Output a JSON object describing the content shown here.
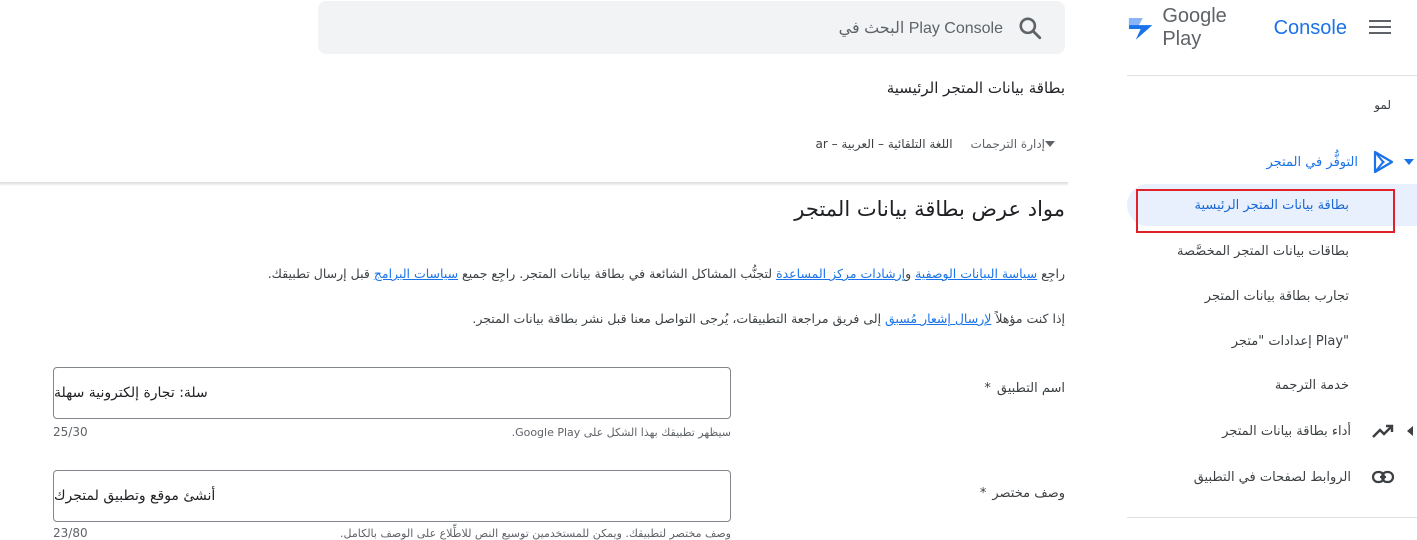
{
  "app": {
    "logo_google_play": "Google Play",
    "logo_console": "Console"
  },
  "search": {
    "placeholder": "البحث في Play Console"
  },
  "sidebar": {
    "truncated_item": "لمو",
    "section": {
      "label": "التوفُّر في المتجر",
      "icon": "play-store-icon"
    },
    "items": [
      {
        "label": "بطاقة بيانات المتجر الرئيسية",
        "active": true
      },
      {
        "label": "بطاقات بيانات المتجر المخصَّصة"
      },
      {
        "label": "تجارب بطاقة بيانات المتجر"
      },
      {
        "label": "إعدادات \"متجر Play\""
      },
      {
        "label": "خدمة الترجمة"
      }
    ],
    "icon_items": [
      {
        "label": "أداء بطاقة بيانات المتجر",
        "icon": "trending-up-icon"
      },
      {
        "label": "الروابط لصفحات في التطبيق",
        "icon": "link-icon"
      }
    ]
  },
  "header": {
    "title": "بطاقة بيانات المتجر الرئيسية",
    "language": "اللغة التلقائية – العربية – ar",
    "manage_translations": "إدارة الترجمات"
  },
  "main": {
    "section_title": "مواد عرض بطاقة بيانات المتجر",
    "para1": {
      "t1": "راجِع ",
      "link1": "سياسة البيانات الوصفية",
      "t2": " و",
      "link2": "إرشادات مركز المساعدة",
      "t3": " لتجنُّب المشاكل الشائعة في بطاقة بيانات المتجر. راجِع جميع ",
      "link3": "سياسات البرامج",
      "t4": " قبل إرسال تطبيقك."
    },
    "para2": {
      "t1": "إذا كنت مؤهلاً ",
      "link1": "لإرسال إشعار مُسبق",
      "t2": " إلى فريق مراجعة التطبيقات، يُرجى التواصل معنا قبل نشر بطاقة بيانات المتجر."
    },
    "fields": [
      {
        "label": "اسم التطبيق",
        "required": "*",
        "value": "سلة: تجارة إلكترونية سهلة",
        "help": "سيظهر تطبيقك بهذا الشكل على Google Play.",
        "counter": "25/30"
      },
      {
        "label": "وصف مختصر",
        "required": "*",
        "value": "أنشئ موقع وتطبيق لمتجرك",
        "help": "وصف مختصر لتطبيقك. ويمكن للمستخدمين توسيع النص للاطِّلاع على الوصف بالكامل.",
        "counter": "23/80"
      }
    ]
  },
  "colors": {
    "accent": "#1a73e8",
    "active_bg": "#e8f0fe",
    "highlight_box": "#e0202a",
    "search_bg": "#f1f3f4"
  }
}
